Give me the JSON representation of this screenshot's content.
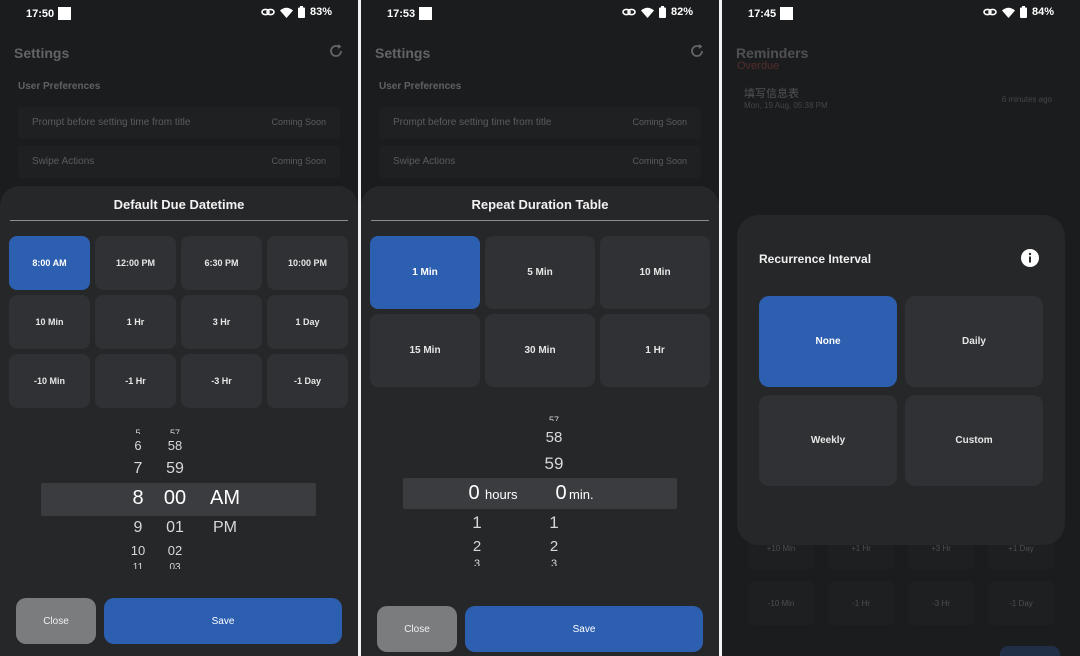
{
  "panels": [
    {
      "status": {
        "time": "17:50",
        "battery": "83%"
      },
      "title": "Settings",
      "section": "User Preferences",
      "rows": [
        {
          "label": "Prompt before setting time from title",
          "value": "Coming Soon"
        },
        {
          "label": "Swipe Actions",
          "value": "Coming Soon"
        }
      ],
      "sheet_title": "Default Due Datetime",
      "options": [
        {
          "label": "8:00 AM",
          "selected": true
        },
        {
          "label": "12:00 PM",
          "selected": false
        },
        {
          "label": "6:30 PM",
          "selected": false
        },
        {
          "label": "10:00 PM",
          "selected": false
        },
        {
          "label": "10 Min",
          "selected": false
        },
        {
          "label": "1 Hr",
          "selected": false
        },
        {
          "label": "3 Hr",
          "selected": false
        },
        {
          "label": "1 Day",
          "selected": false
        },
        {
          "label": "-10 Min",
          "selected": false
        },
        {
          "label": "-1 Hr",
          "selected": false
        },
        {
          "label": "-3 Hr",
          "selected": false
        },
        {
          "label": "-1 Day",
          "selected": false
        }
      ],
      "picker": {
        "hour": [
          "5",
          "6",
          "7",
          "8",
          "9",
          "10",
          "11"
        ],
        "minute": [
          "57",
          "58",
          "59",
          "00",
          "01",
          "02",
          "03"
        ],
        "ampm": [
          "AM",
          "PM"
        ]
      },
      "close_label": "Close",
      "save_label": "Save"
    },
    {
      "status": {
        "time": "17:53",
        "battery": "82%"
      },
      "title": "Settings",
      "section": "User Preferences",
      "rows": [
        {
          "label": "Prompt before setting time from title",
          "value": "Coming Soon"
        },
        {
          "label": "Swipe Actions",
          "value": "Coming Soon"
        }
      ],
      "sheet_title": "Repeat Duration Table",
      "options": [
        {
          "label": "1 Min",
          "selected": true
        },
        {
          "label": "5 Min",
          "selected": false
        },
        {
          "label": "10 Min",
          "selected": false
        },
        {
          "label": "15 Min",
          "selected": false
        },
        {
          "label": "30 Min",
          "selected": false
        },
        {
          "label": "1 Hr",
          "selected": false
        }
      ],
      "picker": {
        "hours_above": [
          "58",
          "59"
        ],
        "minutes_above": [
          "57",
          "58",
          "59"
        ],
        "hours_value": "0",
        "hours_unit": "hours",
        "minutes_value": "0",
        "minutes_unit": "min.",
        "below": [
          "1",
          "2",
          "3"
        ]
      },
      "close_label": "Close",
      "save_label": "Save"
    },
    {
      "status": {
        "time": "17:45",
        "battery": "84%"
      },
      "title": "Reminders",
      "overdue_label": "Overdue",
      "reminder": {
        "title": "填写信息表",
        "date": "Mon, 19 Aug, 05:38 PM",
        "ago": "6 minutes ago"
      },
      "bg_options": [
        "+10 Min",
        "+1 Hr",
        "+3 Hr",
        "+1 Day",
        "-10 Min",
        "-1 Hr",
        "-3 Hr",
        "-1 Day"
      ],
      "dialog_title": "Recurrence Interval",
      "options": [
        {
          "label": "None",
          "selected": true
        },
        {
          "label": "Daily",
          "selected": false
        },
        {
          "label": "Weekly",
          "selected": false
        },
        {
          "label": "Custom",
          "selected": false
        }
      ]
    }
  ],
  "colors": {
    "accent": "#2d5fb0",
    "background": "#1b1c1e",
    "sheet": "#262729",
    "chip": "#303134",
    "overdue": "#e05a4a"
  },
  "icons": [
    "refresh-icon",
    "link-icon",
    "wifi-icon",
    "battery-icon",
    "info-icon"
  ]
}
